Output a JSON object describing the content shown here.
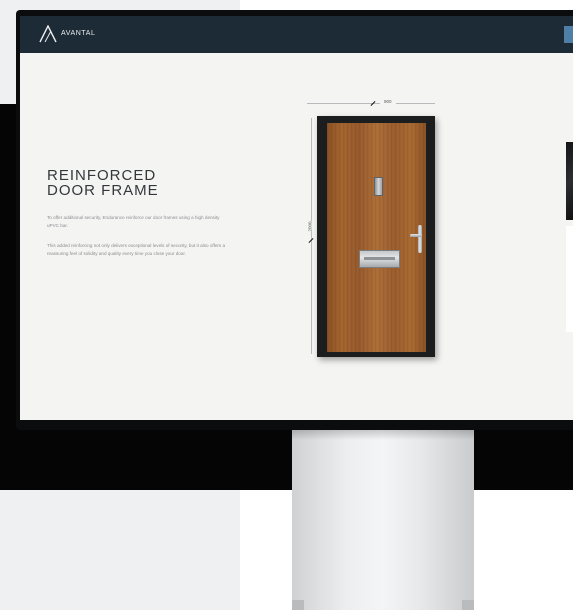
{
  "navbar": {
    "brand": "AVANTAL"
  },
  "main": {
    "heading_line1": "REINFORCED",
    "heading_line2": "DOOR FRAME",
    "paragraph1": "To offer additional security, Endurance reinforce our door frames using a high density uPVC bar.",
    "paragraph2": "This added reinforcing not only delivers exceptional levels of security, but it also offers a reassuring feel of solidity and quality every time you close your door."
  },
  "dimensions": {
    "width_label": "900",
    "height_label": "2000"
  },
  "colors": {
    "navbar": "#1d2b37",
    "accent": "#4f7fa6",
    "door_wood": "#a3632d",
    "frame": "#1b1d1f"
  }
}
